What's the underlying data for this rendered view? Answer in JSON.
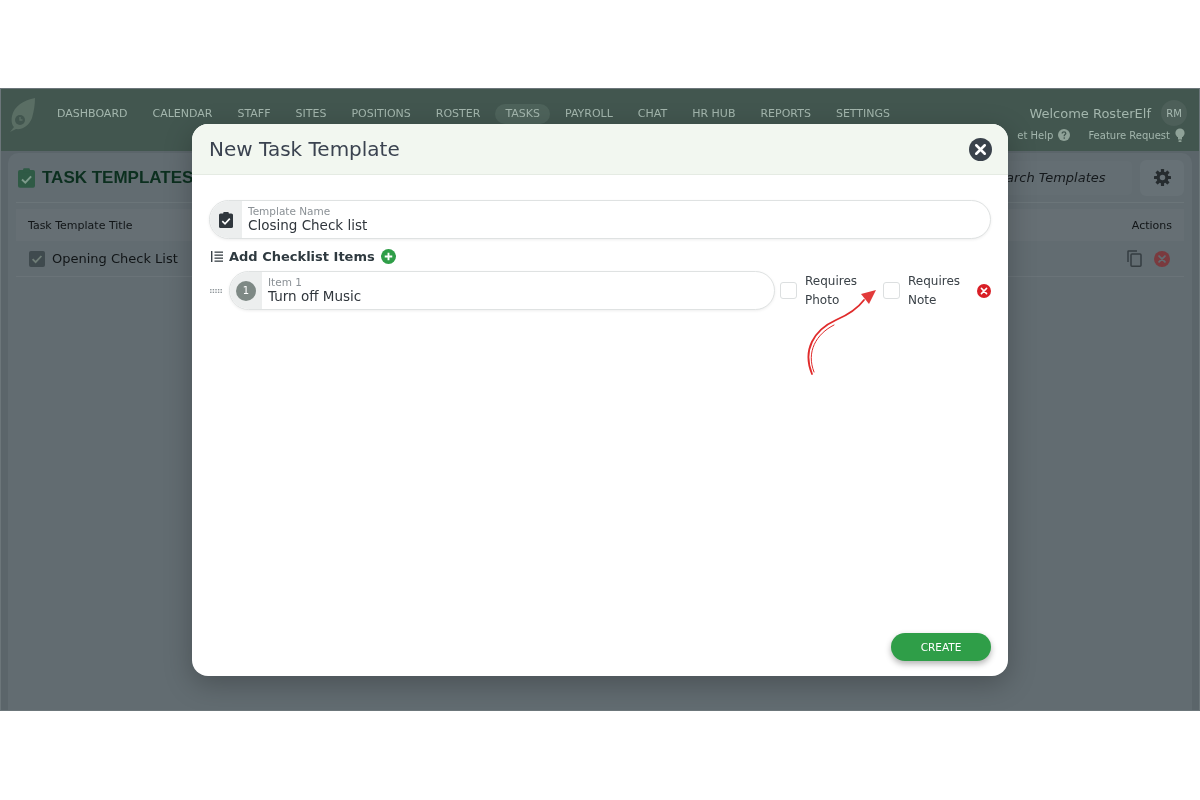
{
  "app": {
    "nav": {
      "items": [
        {
          "label": "DASHBOARD",
          "selected": false
        },
        {
          "label": "CALENDAR",
          "selected": false
        },
        {
          "label": "STAFF",
          "selected": false
        },
        {
          "label": "SITES",
          "selected": false
        },
        {
          "label": "POSITIONS",
          "selected": false
        },
        {
          "label": "ROSTER",
          "selected": false
        },
        {
          "label": "TASKS",
          "selected": true
        },
        {
          "label": "PAYROLL",
          "selected": false
        },
        {
          "label": "CHAT",
          "selected": false
        },
        {
          "label": "HR HUB",
          "selected": false
        },
        {
          "label": "REPORTS",
          "selected": false
        },
        {
          "label": "SETTINGS",
          "selected": false
        }
      ],
      "welcome": "Welcome RosterElf",
      "avatar": "RM",
      "links": [
        {
          "kind": "help",
          "label": "et Help"
        },
        {
          "kind": "idea",
          "label": "Feature Request"
        }
      ]
    },
    "page": {
      "title": "TASK TEMPLATES",
      "search": {
        "placeholder": "arch Templates"
      },
      "table": {
        "columns": [
          "Task Template Title",
          "Actions"
        ],
        "rows": [
          {
            "title": "Opening Check List"
          }
        ]
      }
    }
  },
  "modal": {
    "title": "New Task Template",
    "template_name": {
      "label": "Template Name",
      "value": "Closing Check list"
    },
    "checklist": {
      "heading": "Add Checklist Items",
      "items": [
        {
          "number": "1",
          "label": "Item 1",
          "value": "Turn off Music",
          "options": [
            {
              "label": "Requires Photo",
              "checked": false
            },
            {
              "label": "Requires Note",
              "checked": false
            }
          ]
        }
      ]
    },
    "create_button": "CREATE"
  }
}
